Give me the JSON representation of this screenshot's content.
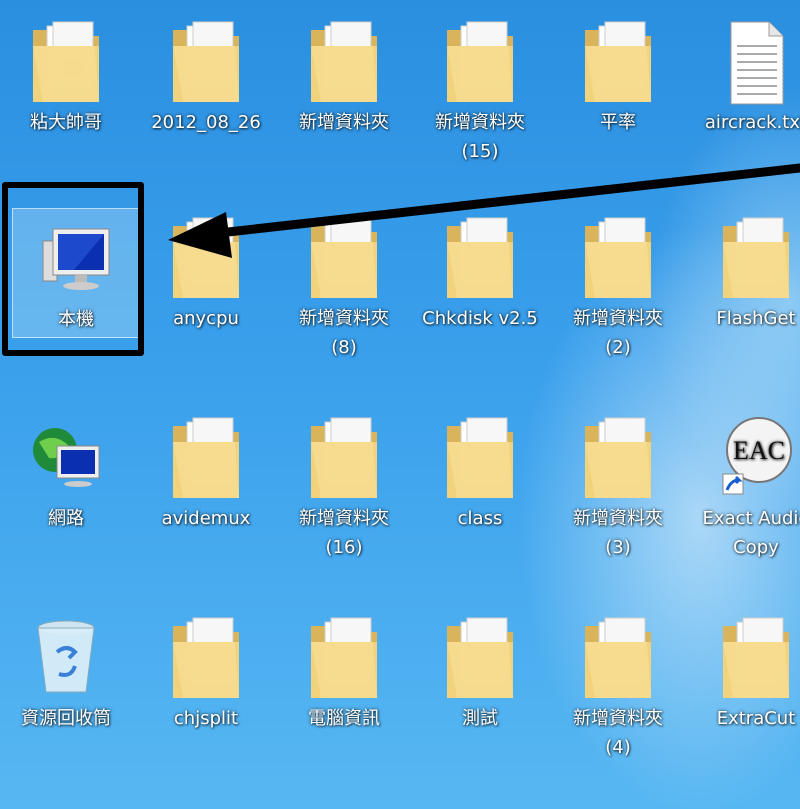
{
  "desktop_icons": [
    {
      "label": "粘大帥哥",
      "type": "user-folder"
    },
    {
      "label": "2012_08_26",
      "type": "folder"
    },
    {
      "label": "新增資料夾",
      "type": "folder"
    },
    {
      "label": "新增資料夾\n(15)",
      "type": "folder"
    },
    {
      "label": "平率",
      "type": "folder"
    },
    {
      "label": "aircrack.txt",
      "type": "text-file"
    },
    {
      "label": "本機",
      "type": "computer",
      "selected": true
    },
    {
      "label": "anycpu",
      "type": "folder"
    },
    {
      "label": "新增資料夾\n(8)",
      "type": "folder"
    },
    {
      "label": "Chkdisk v2.5",
      "type": "folder"
    },
    {
      "label": "新增資料夾\n(2)",
      "type": "folder"
    },
    {
      "label": "FlashGet",
      "type": "folder"
    },
    {
      "label": "網路",
      "type": "network"
    },
    {
      "label": "avidemux",
      "type": "folder"
    },
    {
      "label": "新增資料夾\n(16)",
      "type": "folder"
    },
    {
      "label": "class",
      "type": "folder"
    },
    {
      "label": "新增資料夾\n(3)",
      "type": "folder"
    },
    {
      "label": "Exact Audio\nCopy",
      "type": "app-shortcut",
      "badge": "EAC"
    },
    {
      "label": "資源回收筒",
      "type": "recycle-bin"
    },
    {
      "label": "chjsplit",
      "type": "folder"
    },
    {
      "label": "電腦資訊",
      "type": "folder"
    },
    {
      "label": "測試",
      "type": "folder"
    },
    {
      "label": "新增資料夾\n(4)",
      "type": "folder"
    },
    {
      "label": "ExtraCut",
      "type": "folder"
    }
  ],
  "colors": {
    "desktop": "#3aa0ec",
    "folder": "#f2d480",
    "folder_dark": "#d9b45a",
    "annotation": "#000000"
  }
}
